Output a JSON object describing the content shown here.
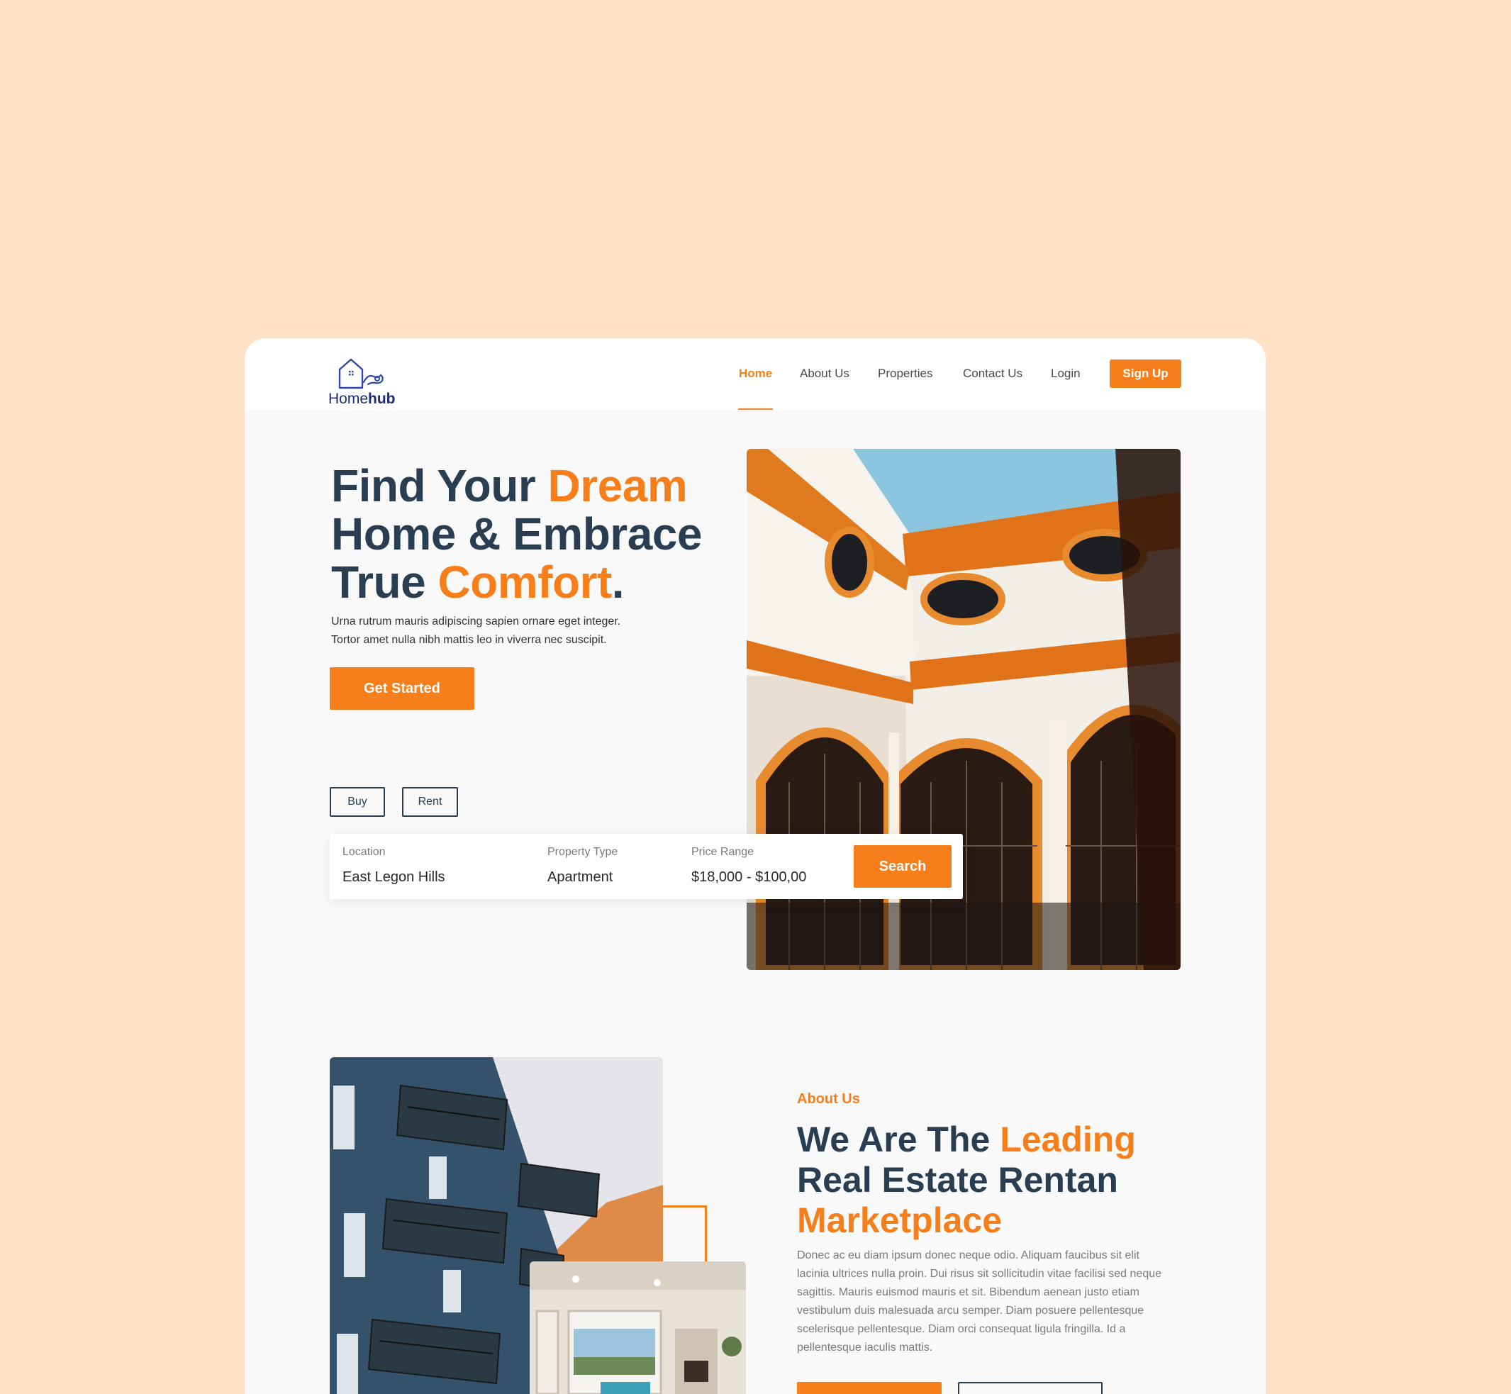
{
  "brand": {
    "name_prefix": "Home",
    "name_suffix": "hub"
  },
  "nav": {
    "items": [
      {
        "label": "Home",
        "active": true
      },
      {
        "label": "About Us"
      },
      {
        "label": "Properties"
      },
      {
        "label": "Contact Us"
      },
      {
        "label": "Login"
      }
    ],
    "signup_label": "Sign Up"
  },
  "hero": {
    "title_parts": [
      "Find Your ",
      "Dream",
      " Home & Embrace True ",
      "Comfort",
      "."
    ],
    "subtitle_line1": "Urna rutrum mauris adipiscing sapien ornare eget integer.",
    "subtitle_line2": "Tortor amet nulla nibh mattis leo in viverra nec suscipit.",
    "cta_label": "Get Started",
    "tabs": [
      "Buy",
      "Rent"
    ]
  },
  "search": {
    "location_label": "Location",
    "location_value": "East Legon Hills",
    "type_label": "Property Type",
    "type_value": "Apartment",
    "price_label": "Price Range",
    "price_value": "$18,000 - $100,00",
    "button_label": "Search"
  },
  "about": {
    "label": "About Us",
    "title_parts": [
      "We Are The ",
      "Leading",
      " Real Estate Rentan ",
      "Marketplace"
    ],
    "body": "Donec ac eu diam ipsum donec neque odio. Aliquam faucibus sit elit lacinia ultrices nulla proin. Dui risus sit sollicitudin vitae facilisi sed neque sagittis. Mauris euismod mauris et sit. Bibendum aenean justo etiam vestibulum duis malesuada arcu semper. Diam posuere pellentesque scelerisque pellentesque. Diam orci consequat ligula fringilla. Id a pellentesque iaculis mattis."
  },
  "colors": {
    "page_bg": "#FFE1C8",
    "accent": "#F77F1B",
    "heading": "#2A3E52",
    "card_bg": "#F9F9F9"
  },
  "icons": [
    "house-logo-icon"
  ]
}
